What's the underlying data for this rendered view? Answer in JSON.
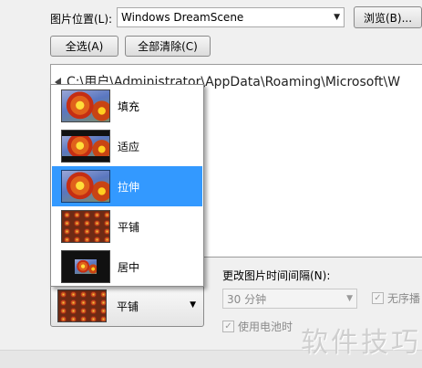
{
  "location": {
    "label": "图片位置(L):",
    "selected": "Windows DreamScene",
    "browse_label": "浏览(B)..."
  },
  "buttons": {
    "select_all": "全选(A)",
    "clear_all": "全部清除(C)"
  },
  "folder_path": "C:\\用户\\Administrator\\AppData\\Roaming\\Microsoft\\W",
  "position_menu": {
    "items": [
      {
        "label": "填充",
        "icon": "fill-thumbnail",
        "selected": false
      },
      {
        "label": "适应",
        "icon": "fit-thumbnail",
        "selected": false
      },
      {
        "label": "拉伸",
        "icon": "stretch-thumbnail",
        "selected": true
      },
      {
        "label": "平铺",
        "icon": "tile-thumbnail",
        "selected": false
      },
      {
        "label": "居中",
        "icon": "center-thumbnail",
        "selected": false
      }
    ],
    "current": "平铺",
    "current_icon": "tile-thumbnail"
  },
  "interval": {
    "label": "更改图片时间间隔(N):",
    "value": "30 分钟",
    "shuffle_label": "无序播",
    "battery_label": "使用电池时"
  },
  "watermark": "软件技巧",
  "colors": {
    "selection": "#3399ff",
    "window_bg": "#f0f0f0"
  }
}
